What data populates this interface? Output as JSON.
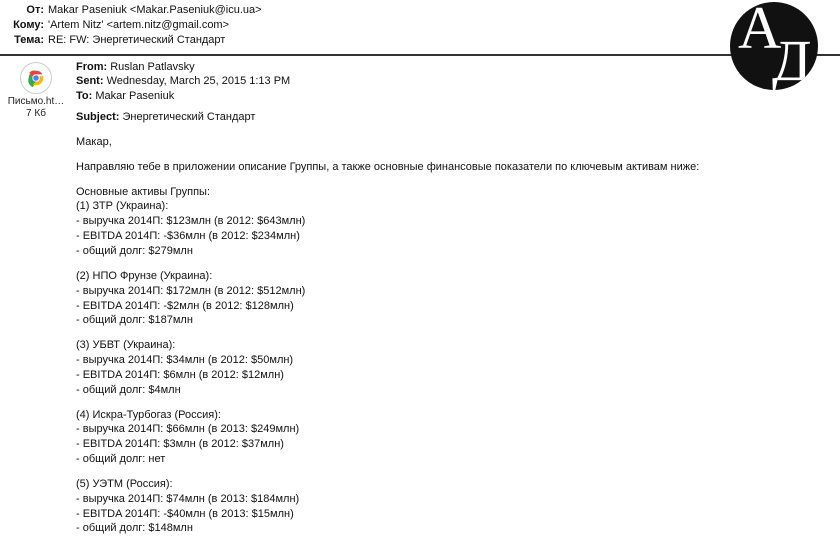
{
  "header": {
    "labels": {
      "from": "От:",
      "to": "Кому:",
      "subject": "Тема:"
    },
    "from": "Makar Paseniuk <Makar.Paseniuk@icu.ua>",
    "to": "'Artem Nitz' <artem.nitz@gmail.com>",
    "subject": "RE: FW: Энергетический Стандарт"
  },
  "attachment": {
    "name": "Письмо.ht…",
    "size": "7 Кб"
  },
  "forwarded": {
    "labels": {
      "from": "From:",
      "sent": "Sent:",
      "to": "To:",
      "subject": "Subject:"
    },
    "from": "Ruslan Patlavsky",
    "sent": "Wednesday, March 25, 2015 1:13 PM",
    "to": "Makar Paseniuk",
    "subject": "Энергетический Стандарт"
  },
  "body": {
    "greeting": "Макар,",
    "intro": "Направляю тебе в приложении описание Группы, а также основные финансовые показатели по ключевым активам ниже:",
    "assets_heading": "Основные активы Группы:",
    "assets": [
      {
        "title": "(1) ЗТР (Украина):",
        "lines": [
          "- выручка 2014П: $123млн (в 2012: $643млн)",
          "- EBITDA 2014П: -$36млн (в 2012: $234млн)",
          "- общий долг: $279млн"
        ]
      },
      {
        "title": "(2) НПО Фрунзе (Украина):",
        "lines": [
          "- выручка 2014П: $172млн (в 2012: $512млн)",
          "- EBITDA 2014П: -$2млн (в 2012: $128млн)",
          "- общий долг: $187млн"
        ]
      },
      {
        "title": "(3) УБВТ (Украина):",
        "lines": [
          "- выручка 2014П: $34млн (в 2012: $50млн)",
          "- EBITDA 2014П: $6млн (в 2012: $12млн)",
          "- общий долг: $4млн"
        ]
      },
      {
        "title": "(4) Искра-Турбогаз (Россия):",
        "lines": [
          "- выручка 2014П: $66млн (в 2013: $249млн)",
          "- EBITDA 2014П: $3млн (в 2012: $37млн)",
          "- общий долг: нет"
        ]
      },
      {
        "title": "(5) УЭТМ (Россия):",
        "lines": [
          "- выручка 2014П: $74млн (в 2013: $184млн)",
          "- EBITDA 2014П: -$40млн (в 2013: $15млн)",
          "- общий долг: $148млн"
        ]
      }
    ]
  },
  "logo": {
    "letters": "АД"
  }
}
